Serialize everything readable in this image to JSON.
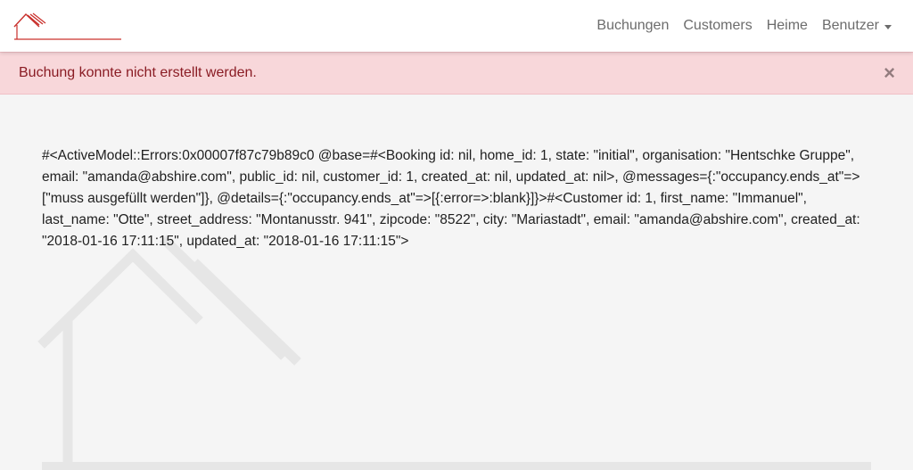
{
  "navbar": {
    "logo": "house-logo",
    "items": [
      {
        "label": "Buchungen"
      },
      {
        "label": "Customers"
      },
      {
        "label": "Heime"
      },
      {
        "label": "Benutzer",
        "dropdown": true
      }
    ]
  },
  "alert": {
    "message": "Buchung konnte nicht erstellt werden.",
    "close_label": "×",
    "color": "#f8d7da"
  },
  "content": {
    "error_dump": "#<ActiveModel::Errors:0x00007f87c79b89c0 @base=#<Booking id: nil, home_id: 1, state: \"initial\", organisation: \"Hentschke Gruppe\", email: \"amanda@abshire.com\", public_id: nil, customer_id: 1, created_at: nil, updated_at: nil>, @messages={:\"occupancy.ends_at\"=>[\"muss ausgefüllt werden\"]}, @details={:\"occupancy.ends_at\"=>[{:error=>:blank}]}>#<Customer id: 1, first_name: \"Immanuel\", last_name: \"Otte\", street_address: \"Montanusstr. 941\", zipcode: \"8522\", city: \"Mariastadt\", email: \"amanda@abshire.com\", created_at: \"2018-01-16 17:11:15\", updated_at: \"2018-01-16 17:11:15\">"
  },
  "colors": {
    "brand": "#c9302c",
    "alert_text": "#8a1c24",
    "nav_text": "#6c6c6c"
  }
}
